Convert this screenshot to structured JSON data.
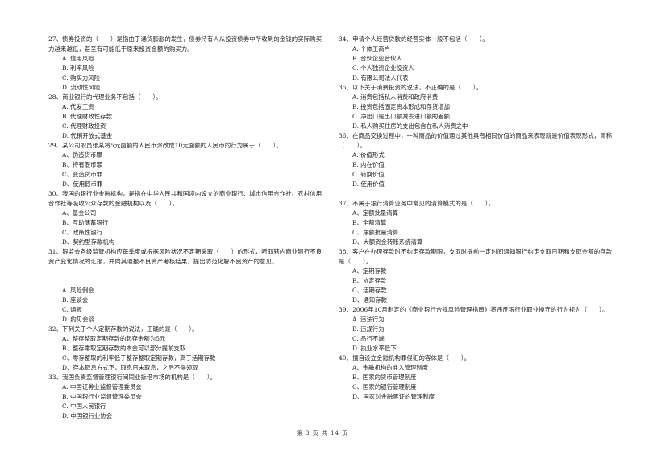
{
  "page": {
    "footer": "第 3 页 共 14 页"
  },
  "left_column": [
    {
      "number": "27",
      "stem": "27、债券投资的（　　）是指由于通货膨胀的发生，债券持有人从投资债券中所收到的金钱的实际购买力越来越低，甚至有可能低于原来投资金额的购买力。",
      "options": [
        "A. 信用风险",
        "B. 利率风险",
        "C. 购买力风险",
        "D. 流动性风险"
      ]
    },
    {
      "number": "28",
      "stem": "28、商业银行的代理业务不包括（　　）。",
      "options": [
        "A. 代发工资",
        "B. 代理财政性存款",
        "C. 代理财政投资",
        "D. 代销开放式基金"
      ]
    },
    {
      "number": "29",
      "stem": "29、某公司职员张某将5元面额的人民币涂改成10元面额的人民币的行为属于（　　）。",
      "options": [
        "A、伪造货币罪",
        "B、持有假币罪",
        "C、变造货币罪",
        "D、使用假币罪"
      ]
    },
    {
      "number": "30",
      "stem": "30、我国的银行业金融机构，是指在中华人民共和国境内设立的商业银行、城市信用合作社、农村信用合作社等吸收公众存款的金融机构以及（　　）。",
      "options": [
        "A、基金公司",
        "B、互助储蓄银行",
        "C、政策性银行",
        "D、契约型存款机构"
      ]
    },
    {
      "number": "31",
      "stem": "31、银监会各级监管机构应每季度或根据风险状况不定期采取（　　）的形式，听取辖内商业银行不良资产变化情况的汇报，并向其通报不良资产考核结果，提出防范化解不良资产的意见。",
      "options": [
        "A. 风险例会",
        "B. 座谈会",
        "C. 通报",
        "D. 约见会谈"
      ]
    },
    {
      "number": "32",
      "stem": "32、下列关于个人定期存款的说法，正确的是（　　）。",
      "options": [
        "A、整存整取定期存款的起存金额为5元",
        "B、整存零取定期存款的本金可以部分提前支取",
        "C、零存整取的利率低于整存整取定期存款，高于活期存款",
        "D、存本取息方式下，取息日未取息，之后不得领取"
      ]
    },
    {
      "number": "33",
      "stem": "33、我国负责监督管理银行间同业拆借市场的机构是（　　）。",
      "options": [
        "A. 中国证券业监督管理委员会",
        "B. 中国银行业监督管理委员会",
        "C. 中国人民银行",
        "D. 中国银行业协会"
      ]
    }
  ],
  "right_column": [
    {
      "number": "34",
      "stem": "34、申请个人经营贷款的经营实体一般不包括（　　）。",
      "options": [
        "A. 个体工商户",
        "B. 合伙企业合伙人",
        "C. 个人独资企业投资人",
        "D. 有限公司法人代表"
      ]
    },
    {
      "number": "35",
      "stem": "35、以下关于消费投资的说法，不正确的是（　　）。",
      "options": [
        "A. 消费包括私人消费和政府消费",
        "B. 投资包括固定资本形成和存货增加",
        "C. 净出口是出口额减去进口额的差额",
        "D. 私人购买住房的支出包含在私人消费之中"
      ]
    },
    {
      "number": "36",
      "stem": "36、在商品交换过程中，一种商品的价值通过其他具有相同价值的商品来表现就是价值表现形式，简称（　　）。",
      "options": [
        "A. 价值形式",
        "B. 内在价值",
        "C. 转换价值",
        "D. 使用价值"
      ]
    },
    {
      "number": "37",
      "stem": "37、不属于银行清算业务中常见的清算模式的是（　　）。",
      "options": [
        "A、定额批量清算",
        "B、全额清算",
        "C、净额批量清算",
        "D、大额资金转账系统清算"
      ]
    },
    {
      "number": "38",
      "stem": "38、客户在办理存款时不约定存款期限，支取时提前一定时间通知银行约定支取日期和支取金额的存款是（　　）。",
      "options": [
        "A、定期存款",
        "B、协定存款",
        "C、活期存款",
        "D、通知存款"
      ]
    },
    {
      "number": "39",
      "stem": "39、2006年10月制定的《商业银行合规风险管理指南》将违反银行业职业操守的行为视为（　　）。",
      "options": [
        "A. 违法行为",
        "B. 违规行为",
        "C. 品行不端",
        "D. 执业水平低下"
      ]
    },
    {
      "number": "40",
      "stem": "40、擅自设立金融机构罪侵犯的客体是（　　）。",
      "options": [
        "A、金融机构的准入管理制度",
        "B、国家的货币管理制度",
        "C、国家的银行管理制度",
        "D、国家对金融票证的管理制度"
      ]
    }
  ]
}
